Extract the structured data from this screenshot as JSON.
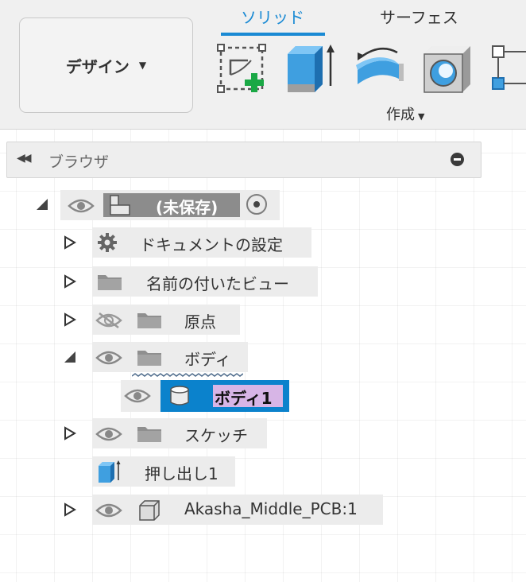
{
  "toolbar": {
    "workspace_label": "デザイン",
    "tabs": [
      {
        "label": "ソリッド",
        "active": true
      },
      {
        "label": "サーフェス",
        "active": false
      }
    ],
    "tools": [
      "create-sketch-icon",
      "extrude-icon",
      "revolve-icon",
      "hole-icon",
      "pattern-icon"
    ],
    "group_label": "作成"
  },
  "browser": {
    "title": "ブラウザ",
    "root": {
      "label": "(未保存)"
    },
    "items": [
      {
        "label": "ドキュメントの設定"
      },
      {
        "label": "名前の付いたビュー"
      },
      {
        "label": "原点"
      },
      {
        "label": "ボディ"
      },
      {
        "label": "ボディ1"
      },
      {
        "label": "スケッチ"
      },
      {
        "label": "押し出し1"
      },
      {
        "label": "Akasha_Middle_PCB:1"
      }
    ]
  },
  "colors": {
    "accent": "#1a8ad4",
    "selection": "#0b82cc",
    "edit_highlight": "#d7b5e6",
    "add_icon_green": "#1aa845"
  }
}
